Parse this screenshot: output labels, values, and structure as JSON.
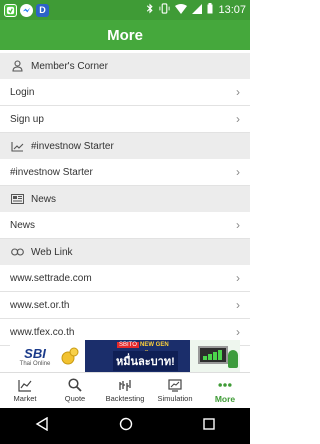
{
  "status_bar": {
    "time": "13:07",
    "left_icons": [
      "app-notification-icon",
      "messenger-icon",
      "d-app-icon"
    ],
    "right_icons": [
      "bluetooth-icon",
      "vibrate-icon",
      "wifi-icon",
      "signal-icon",
      "battery-icon"
    ],
    "d_letter": "D"
  },
  "app_bar": {
    "title": "More"
  },
  "sections": [
    {
      "header": "Member's Corner",
      "icon": "person-icon",
      "items": [
        "Login",
        "Sign up"
      ]
    },
    {
      "header": "#investnow Starter",
      "icon": "trend-chart-icon",
      "items": [
        "#investnow Starter"
      ]
    },
    {
      "header": "News",
      "icon": "newspaper-icon",
      "items": [
        "News"
      ]
    },
    {
      "header": "Web Link",
      "icon": "link-icon",
      "items": [
        "www.settrade.com",
        "www.set.or.th",
        "www.tfex.co.th"
      ]
    }
  ],
  "banner": {
    "brand": "SBI",
    "brand_sub": "Thai Online",
    "tag": "SBITO",
    "tagline": "NEW GEN หลักสูตร",
    "headline": "หมื่นละบาท!"
  },
  "bottom_nav": {
    "items": [
      {
        "label": "Market",
        "icon": "market-chart-icon",
        "active": false
      },
      {
        "label": "Quote",
        "icon": "search-icon",
        "active": false
      },
      {
        "label": "Backtesting",
        "icon": "backtesting-icon",
        "active": false
      },
      {
        "label": "Simulation",
        "icon": "simulation-icon",
        "active": false
      },
      {
        "label": "More",
        "icon": "more-dots-icon",
        "active": true
      }
    ]
  },
  "colors": {
    "status_bar": "#3f9b36",
    "app_bar": "#45a83c",
    "accent": "#3f9b36",
    "section_bg": "#ececec"
  }
}
